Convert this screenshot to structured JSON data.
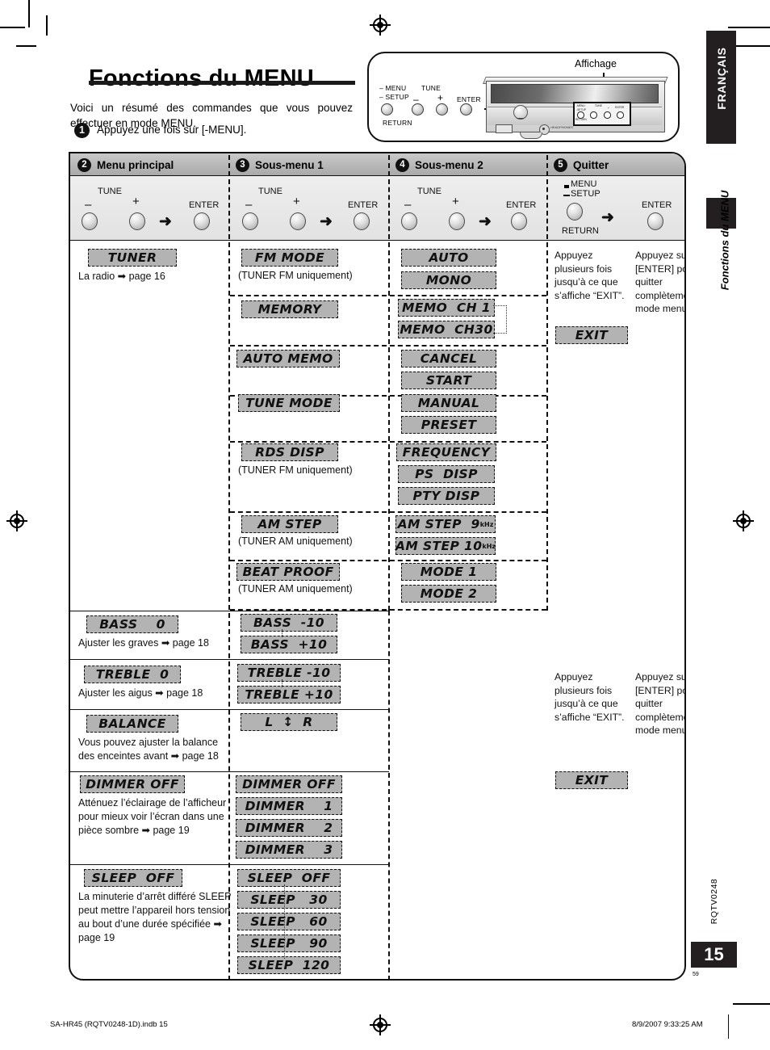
{
  "page": {
    "title": "Fonctions du MENU",
    "intro": "Voici un résumé des commandes que vous pouvez effectuer en mode MENU.",
    "step1_badge": "1",
    "step1_text": "Appuyez une fois sur [-MENU].",
    "language_tab": "FRANÇAIS",
    "section_tab": "Fonctions du MENU",
    "doc_code": "RQTV0248",
    "page_number": "15",
    "small_folio": "59"
  },
  "footer": {
    "left": "SA-HR45 (RQTV0248-1D).indb   15",
    "right": "8/9/2007   9:33:25 AM"
  },
  "device": {
    "affichage_label": "Affichage",
    "buttons": [
      {
        "line1": "– MENU",
        "line2": "– SETUP",
        "line3": "RETURN"
      },
      {
        "label": "TUNE"
      },
      {
        "label": "–"
      },
      {
        "label": "+"
      },
      {
        "label": "ENTER"
      }
    ],
    "panel_mini_labels": {
      "menu": "-MENU",
      "setup": "-SETUP",
      "return": "RETURN",
      "tune": "TUNE",
      "minus": "-",
      "plus": "+",
      "enter": "ENTER"
    },
    "jack_label": "HEADPHONES"
  },
  "columns": [
    {
      "badge": "2",
      "label": "Menu principal"
    },
    {
      "badge": "3",
      "label": "Sous-menu 1"
    },
    {
      "badge": "4",
      "label": "Sous-menu 2"
    },
    {
      "badge": "5",
      "label": "Quitter"
    }
  ],
  "button_rows": [
    {
      "tune": "TUNE",
      "minus": "–",
      "plus": "+",
      "arrow": "➜",
      "enter": "ENTER"
    },
    {
      "tune": "TUNE",
      "minus": "–",
      "plus": "+",
      "arrow": "➜",
      "enter": "ENTER"
    },
    {
      "tune": "TUNE",
      "minus": "–",
      "plus": "+",
      "arrow": "➜",
      "enter": "ENTER"
    },
    {
      "menu": "MENU",
      "setup": "SETUP",
      "return": "RETURN",
      "arrow": "➜",
      "enter": "ENTER"
    }
  ],
  "main_menu": [
    {
      "chip": "TUNER",
      "note": "La radio ➡ page 16",
      "submenus": [
        {
          "chip": "FM MODE",
          "note": "(TUNER FM uniquement)",
          "options": [
            "AUTO",
            "MONO"
          ]
        },
        {
          "chip": "MEMORY",
          "note": "",
          "options": [
            "MEMO  CH 1",
            "MEMO  CH30"
          ]
        },
        {
          "chip": "AUTO MEMO",
          "note": "",
          "options": [
            "CANCEL",
            "START"
          ]
        },
        {
          "chip": "TUNE MODE",
          "note": "",
          "options": [
            "MANUAL",
            "PRESET"
          ]
        },
        {
          "chip": "RDS DISP",
          "note": "(TUNER FM uniquement)",
          "options": [
            "FREQUENCY",
            "PS  DISP",
            "PTY DISP"
          ]
        },
        {
          "chip": "AM STEP",
          "note": "(TUNER AM uniquement)",
          "options": [
            "AM STEP  9",
            "AM STEP 10"
          ],
          "option_sub": "kHz"
        },
        {
          "chip": "BEAT PROOF",
          "note": "(TUNER AM uniquement)",
          "options": [
            "MODE 1",
            "MODE 2"
          ]
        }
      ]
    },
    {
      "chip": "BASS    0",
      "note": "Ajuster les graves ➡ page 18",
      "submenus": [
        {
          "chip": "BASS  -10",
          "note": "",
          "options": []
        },
        {
          "chip": "BASS  +10",
          "note": "",
          "options": []
        }
      ]
    },
    {
      "chip": "TREBLE  0",
      "note": "Ajuster les aigus ➡ page 18",
      "submenus": [
        {
          "chip": "TREBLE -10",
          "note": "",
          "options": []
        },
        {
          "chip": "TREBLE +10",
          "note": "",
          "options": []
        }
      ]
    },
    {
      "chip": "BALANCE",
      "note": "Vous pouvez ajuster la balance des enceintes avant ➡ page 18",
      "submenus": [
        {
          "chip": "L  ↕  R",
          "note": "",
          "options": []
        }
      ]
    },
    {
      "chip": "DIMMER OFF",
      "note": "Atténuez l’éclairage de l’afficheur pour mieux voir l’écran dans une pièce sombre ➡ page 19",
      "submenus": [
        {
          "chip": "DIMMER OFF",
          "note": "",
          "options": []
        },
        {
          "chip": "DIMMER    1",
          "note": "",
          "options": []
        },
        {
          "chip": "DIMMER    2",
          "note": "",
          "options": []
        },
        {
          "chip": "DIMMER    3",
          "note": "",
          "options": []
        }
      ]
    },
    {
      "chip": "SLEEP  OFF",
      "note": "La minuterie d’arrêt différé SLEEP peut mettre l’appareil hors tension au bout d’une durée spécifiée ➡ page 19",
      "submenus": [
        {
          "chip": "SLEEP  OFF",
          "note": "",
          "options": []
        },
        {
          "chip": "SLEEP   30",
          "note": "",
          "options": []
        },
        {
          "chip": "SLEEP   60",
          "note": "",
          "options": []
        },
        {
          "chip": "SLEEP   90",
          "note": "",
          "options": []
        },
        {
          "chip": "SLEEP  120",
          "note": "",
          "options": []
        }
      ]
    }
  ],
  "quit": {
    "note_left": "Appuyez plusieurs fois jusqu’à ce que s’affiche “EXIT”.",
    "note_right": "Appuyez sur [ENTER] pour quitter complètement le mode menu.",
    "exit_chip": "EXIT"
  },
  "colors": {
    "chip_fill": "#b3b3b3",
    "header_fill": "#b4b4b4",
    "ink": "#111111",
    "tab_black": "#231f20"
  }
}
